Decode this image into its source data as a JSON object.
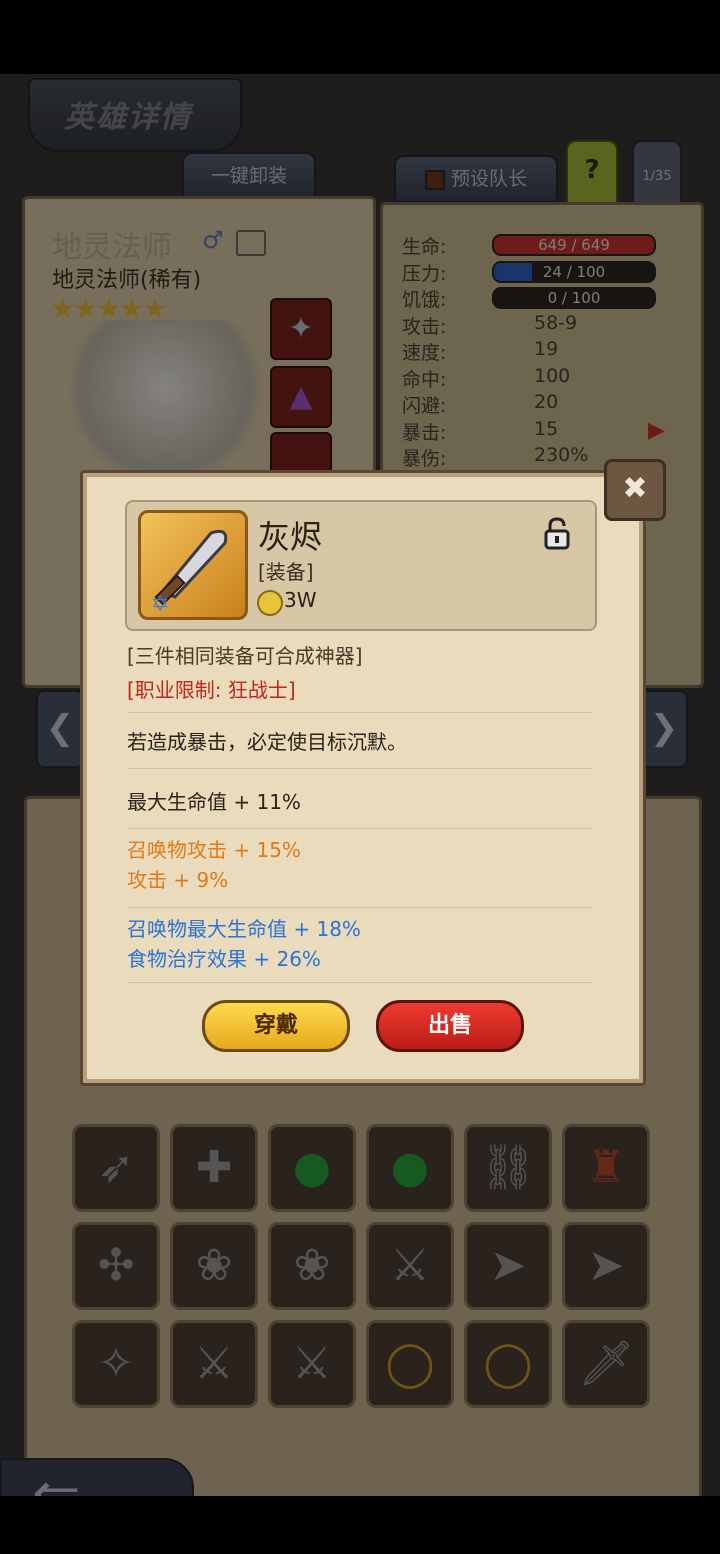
{
  "header": {
    "title": "英雄详情"
  },
  "top_buttons": {
    "unequip_all": "一键卸装",
    "preset_captain": "预设队长",
    "help": "?",
    "page_counter": "1/35"
  },
  "hero": {
    "name": "地灵法师",
    "subtitle": "地灵法师(稀有)",
    "stars": 5
  },
  "stats": [
    {
      "label": "生命:",
      "value": "649 / 649",
      "bar": "red",
      "fill": 1.0
    },
    {
      "label": "压力:",
      "value": "24 / 100",
      "bar": "blue",
      "fill": 0.24
    },
    {
      "label": "饥饿:",
      "value": "0 / 100",
      "bar": "dark",
      "fill": 0.0
    },
    {
      "label": "攻击:",
      "value": "58-9"
    },
    {
      "label": "速度:",
      "value": "19"
    },
    {
      "label": "命中:",
      "value": "100"
    },
    {
      "label": "闪避:",
      "value": "20"
    },
    {
      "label": "暴击:",
      "value": "15"
    },
    {
      "label": "暴伤:",
      "value": "230%"
    }
  ],
  "item": {
    "name": "灰烬",
    "type": "[装备]",
    "price": "3W",
    "lines": [
      {
        "text": "[三件相同装备可合成神器]",
        "color": "#4a3a28"
      },
      {
        "text": "[职业限制: 狂战士]",
        "color": "#c0281c"
      },
      {
        "text": "若造成暴击，必定使目标沉默。",
        "color": "#2b2218"
      },
      {
        "text": "最大生命值 + 11%",
        "color": "#2b2218"
      },
      {
        "text": "召唤物攻击 + 15%",
        "color": "#e07b18"
      },
      {
        "text": "攻击 + 9%",
        "color": "#e07b18"
      },
      {
        "text": "召唤物最大生命值 + 18%",
        "color": "#2b73d6"
      },
      {
        "text": "食物治疗效果 + 26%",
        "color": "#2b73d6"
      }
    ],
    "equip_label": "穿戴",
    "sell_label": "出售"
  },
  "inventory_rows": [
    [
      "bow-icon",
      "crossbow-icon",
      "green-potion-icon",
      "green-potion-icon",
      "chain-icon",
      "armor-icon"
    ],
    [
      "axe-icon",
      "fan-icon",
      "fan-icon",
      "halberd-icon",
      "spear-icon",
      "spear-icon"
    ],
    [
      "staff-icon",
      "sword-icon",
      "sword-icon",
      "ring-icon",
      "ring-icon",
      "dagger-icon"
    ]
  ]
}
